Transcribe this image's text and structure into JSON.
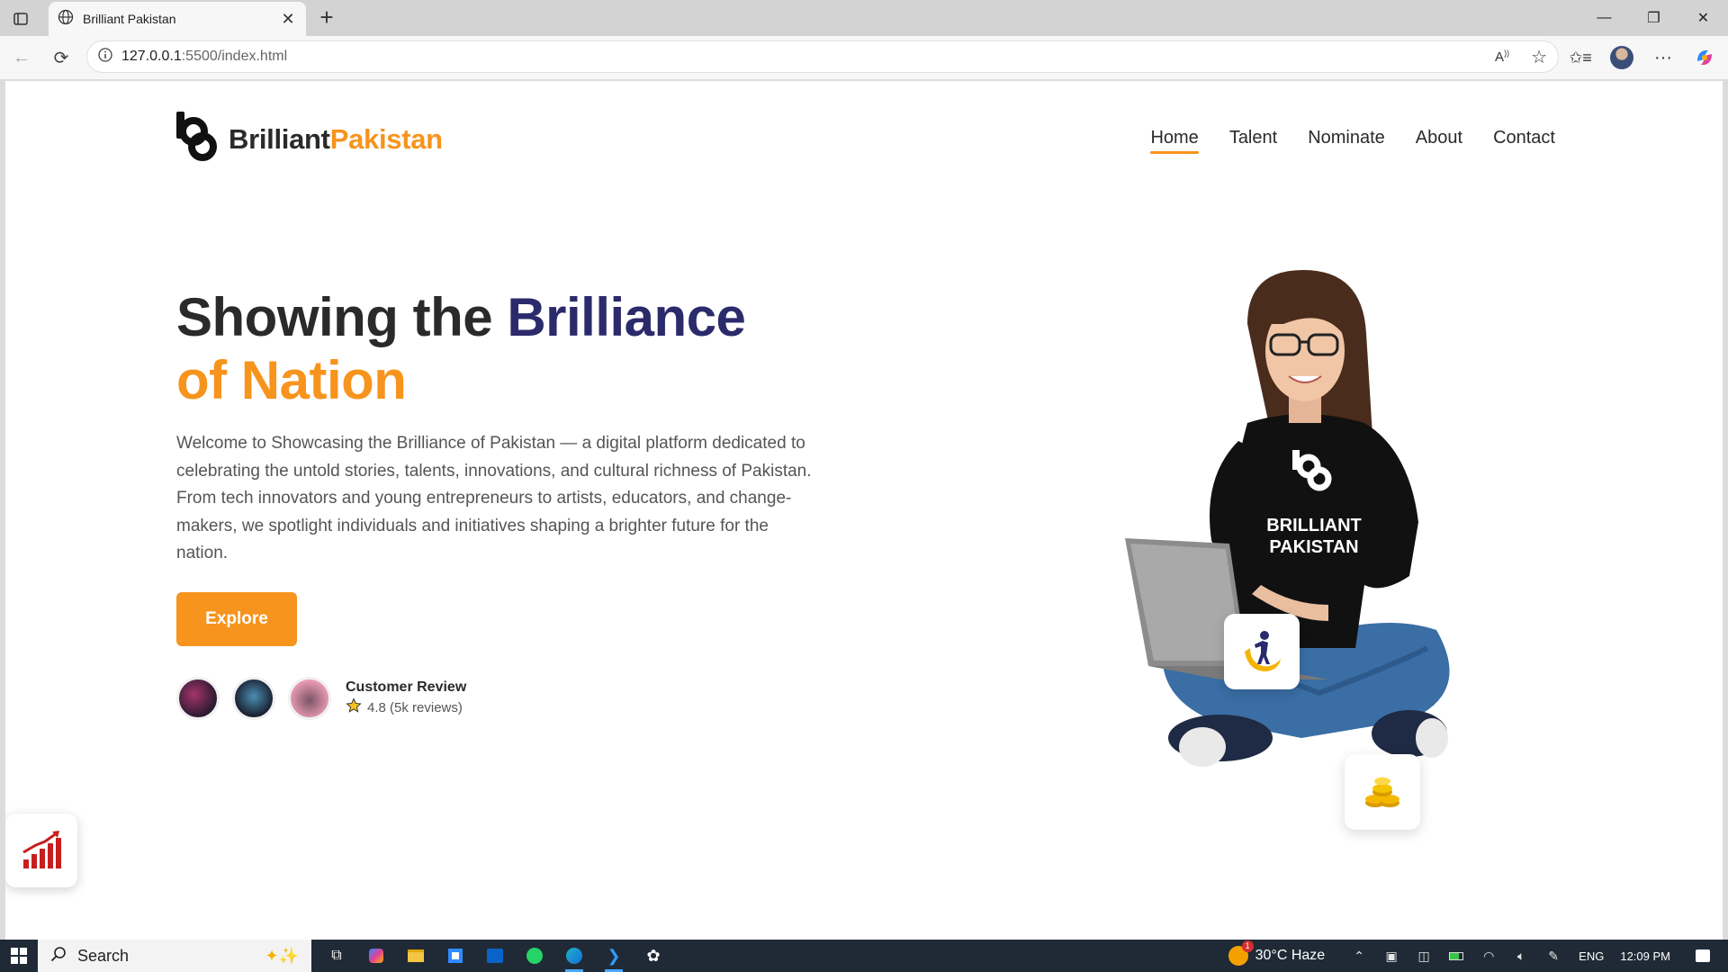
{
  "browser": {
    "tab_title": "Brilliant Pakistan",
    "url_host": "127.0.0.1",
    "url_rest": ":5500/index.html"
  },
  "site": {
    "logo_part1": "Brilliant",
    "logo_part2": "Pakistan",
    "nav": [
      {
        "label": "Home",
        "active": true
      },
      {
        "label": "Talent"
      },
      {
        "label": "Nominate"
      },
      {
        "label": "About"
      },
      {
        "label": "Contact"
      }
    ]
  },
  "hero": {
    "title_part1": "Showing the ",
    "title_part2": "Brilliance",
    "title_part3": "of Nation",
    "description": "Welcome to Showcasing the Brilliance of Pakistan — a digital platform dedicated to celebrating the untold stories, talents, innovations, and cultural richness of Pakistan. From tech innovators and young entrepreneurs to artists, educators, and change-makers, we spotlight individuals and initiatives shaping a brighter future for the nation.",
    "cta_label": "Explore"
  },
  "reviews": {
    "title": "Customer Review",
    "rating_text": "4.8 (5k reviews)"
  },
  "illustration": {
    "shirt_line1": "BRILLIANT",
    "shirt_line2": "PAKISTAN"
  },
  "taskbar": {
    "search_label": "Search",
    "weather": "30°C  Haze",
    "language": "ENG",
    "time": "12:09 PM",
    "weather_badge": "1"
  },
  "colors": {
    "accent": "#f7941d",
    "navy": "#2b2a6b",
    "text": "#2a2a2a"
  }
}
